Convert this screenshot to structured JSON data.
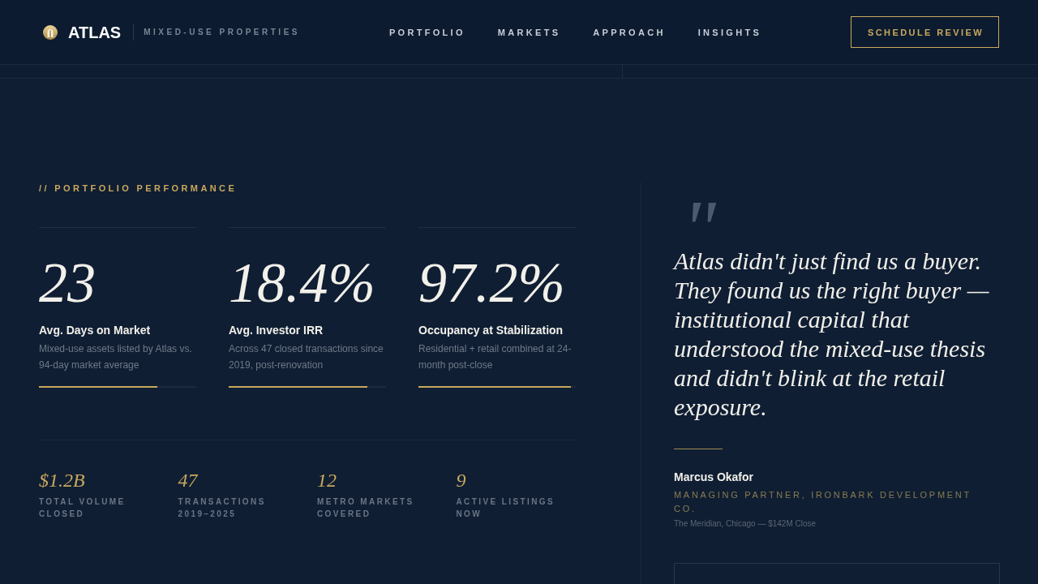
{
  "header": {
    "brand": "ATLAS",
    "tagline": "MIXED-USE PROPERTIES",
    "nav": [
      {
        "label": "PORTFOLIO",
        "selected": false
      },
      {
        "label": "MARKETS",
        "selected": false
      },
      {
        "label": "APPROACH",
        "selected": false
      },
      {
        "label": "INSIGHTS",
        "selected": false
      }
    ],
    "cta": "SCHEDULE REVIEW"
  },
  "performance": {
    "eyebrow": "// PORTFOLIO PERFORMANCE",
    "metrics": [
      {
        "value": "23",
        "label": "Avg. Days on Market",
        "description": "Mixed-use assets listed by Atlas vs. 94-day market average",
        "level": 0.75
      },
      {
        "value": "18.4%",
        "label": "Avg. Investor IRR",
        "description": "Across 47 closed transactions since 2019, post-renovation",
        "level": 0.88
      },
      {
        "value": "97.2%",
        "label": "Occupancy at Stabilization",
        "description": "Residential + retail combined at 24-month post-close",
        "level": 0.97
      }
    ],
    "totals": [
      {
        "value": "$1.2B",
        "label": "TOTAL VOLUME CLOSED"
      },
      {
        "value": "47",
        "label": "TRANSACTIONS 2019–2025"
      },
      {
        "value": "12",
        "label": "METRO MARKETS COVERED"
      },
      {
        "value": "9",
        "label": "ACTIVE LISTINGS NOW"
      }
    ]
  },
  "testimonial": {
    "quote_mark": "\"",
    "quote": "Atlas didn't just find us a buyer. They found us the right buyer — institutional capital that understood the mixed-use thesis and didn't blink at the retail exposure.",
    "name": "Marcus Okafor",
    "role": "MANAGING PARTNER, IRONBARK DEVELOPMENT CO.",
    "deal": "The Meridian, Chicago — $142M Close"
  }
}
